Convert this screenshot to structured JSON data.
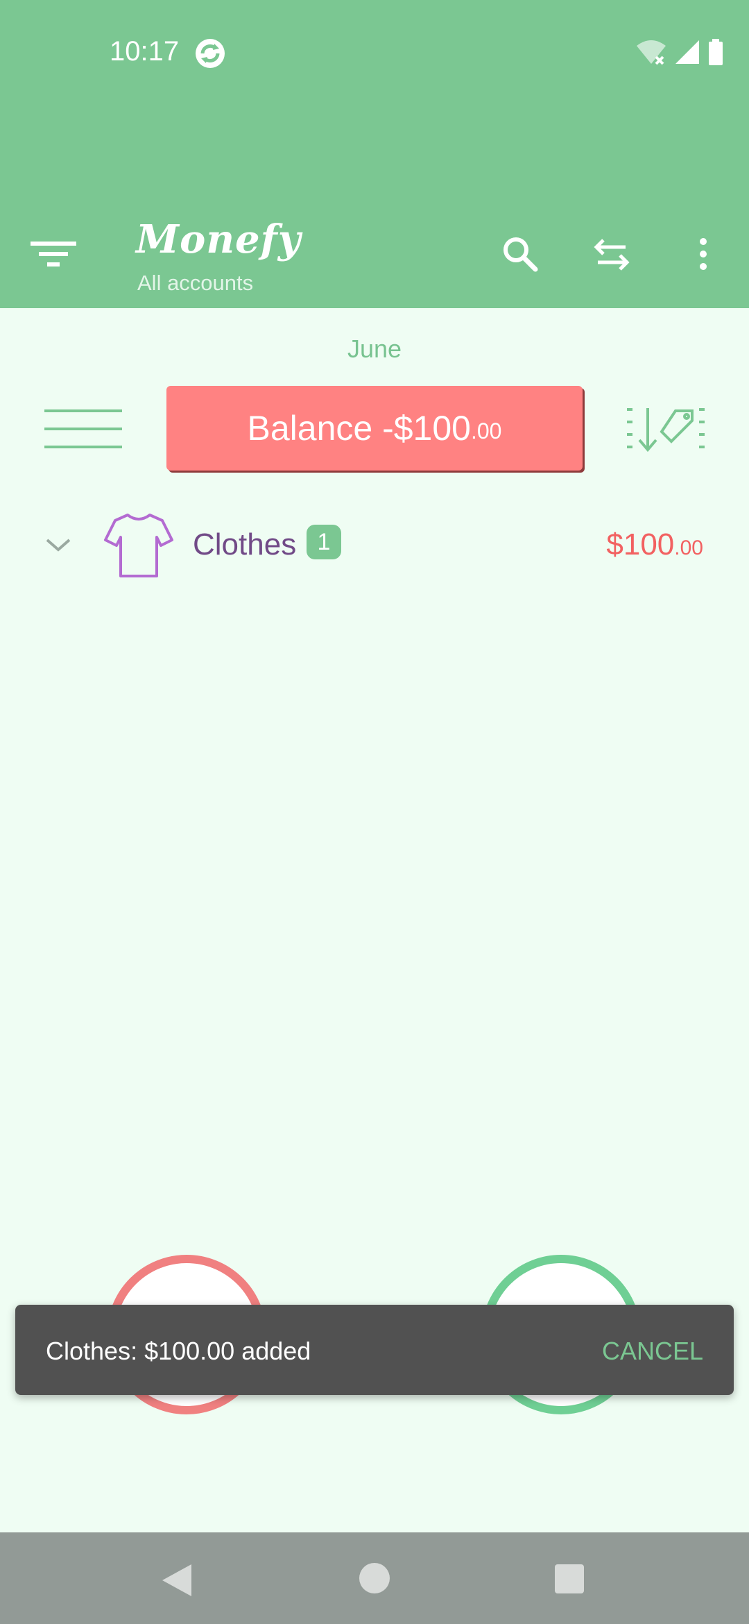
{
  "status_bar": {
    "time": "10:17",
    "icons": [
      "sync-icon",
      "wifi-off-icon",
      "signal-icon",
      "battery-icon"
    ]
  },
  "app_bar": {
    "title": "Monefy",
    "subtitle": "All accounts",
    "icons": [
      "filter-menu-icon",
      "search-icon",
      "transfer-icon",
      "more-vert-icon"
    ]
  },
  "main": {
    "period": "June",
    "balance": {
      "label": "Balance -$100",
      "cents": ".00"
    },
    "categories": [
      {
        "name": "Clothes",
        "count": "1",
        "amount": "$100",
        "cents": ".00",
        "icon": "shirt-icon"
      }
    ]
  },
  "snackbar": {
    "message": "Clothes: $100.00 added",
    "action": "CANCEL"
  },
  "colors": {
    "header": "#7bc792",
    "background": "#effdf3",
    "balance_negative": "#ff8282",
    "expense": "#f08080",
    "income": "#6fcf94",
    "category_text": "#714a87",
    "amount_text": "#f26161"
  },
  "nav_bar": {
    "icons": [
      "back-icon",
      "home-icon",
      "recents-icon"
    ]
  }
}
